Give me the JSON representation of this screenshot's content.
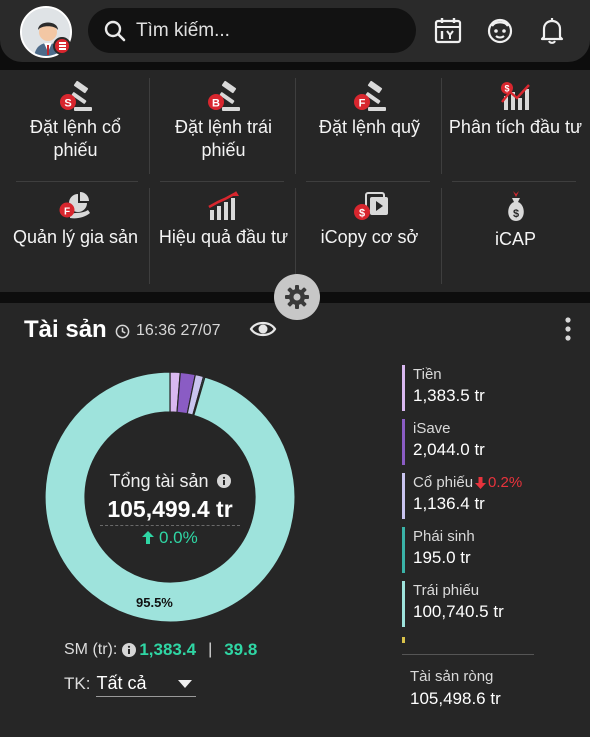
{
  "header": {
    "search_placeholder": "Tìm kiếm..."
  },
  "menu": {
    "items": [
      {
        "label": "Đặt lệnh cổ phiếu",
        "icon": "stock-order-gavel-icon"
      },
      {
        "label": "Đặt lệnh trái phiếu",
        "icon": "bond-order-gavel-icon"
      },
      {
        "label": "Đặt lệnh quỹ",
        "icon": "fund-order-gavel-icon"
      },
      {
        "label": "Phân tích đầu tư",
        "icon": "investment-analysis-chart-icon"
      },
      {
        "label": "Quản lý gia sản",
        "icon": "wealth-management-icon"
      },
      {
        "label": "Hiệu quả đầu tư",
        "icon": "investment-performance-chart-icon"
      },
      {
        "label": "iCopy cơ sở",
        "icon": "icopy-icon"
      },
      {
        "label": "iCAP",
        "icon": "icap-money-bag-icon"
      }
    ]
  },
  "assets": {
    "title": "Tài sản",
    "time": "16:36 27/07",
    "total_label": "Tổng tài sản",
    "total_value": "105,499.4 tr",
    "total_change": "0.0%",
    "bond_share_label": "95.5%",
    "sm_label": "SM (tr):",
    "sm_value_1": "1,383.4",
    "sm_separator": "|",
    "sm_value_2": "39.8",
    "account_label": "TK:",
    "account_value": "Tất cả",
    "legend": [
      {
        "name": "Tiền",
        "value": "1,383.5 tr",
        "color": "#d9b8f0"
      },
      {
        "name": "iSave",
        "value": "2,044.0 tr",
        "color": "#8a5cc4"
      },
      {
        "name": "Cổ phiếu",
        "value": "1,136.4 tr",
        "color": "#c9c4ef",
        "change": "0.2%"
      },
      {
        "name": "Phái sinh",
        "value": "195.0 tr",
        "color": "#3ab3a8"
      },
      {
        "name": "Trái phiếu",
        "value": "100,740.5 tr",
        "color": "#9ee3dc"
      }
    ],
    "net_label": "Tài sản ròng",
    "net_value": "105,498.6 tr"
  },
  "chart_data": {
    "type": "pie",
    "categories": [
      "Tiền",
      "iSave",
      "Cổ phiếu",
      "Phái sinh",
      "Trái phiếu"
    ],
    "values": [
      1383.5,
      2044.0,
      1136.4,
      195.0,
      100740.5
    ],
    "colors": [
      "#d9b8f0",
      "#8a5cc4",
      "#c9c4ef",
      "#3ab3a8",
      "#9ee3dc"
    ],
    "data_labels": [
      "",
      "",
      "",
      "",
      "95.5%"
    ]
  }
}
